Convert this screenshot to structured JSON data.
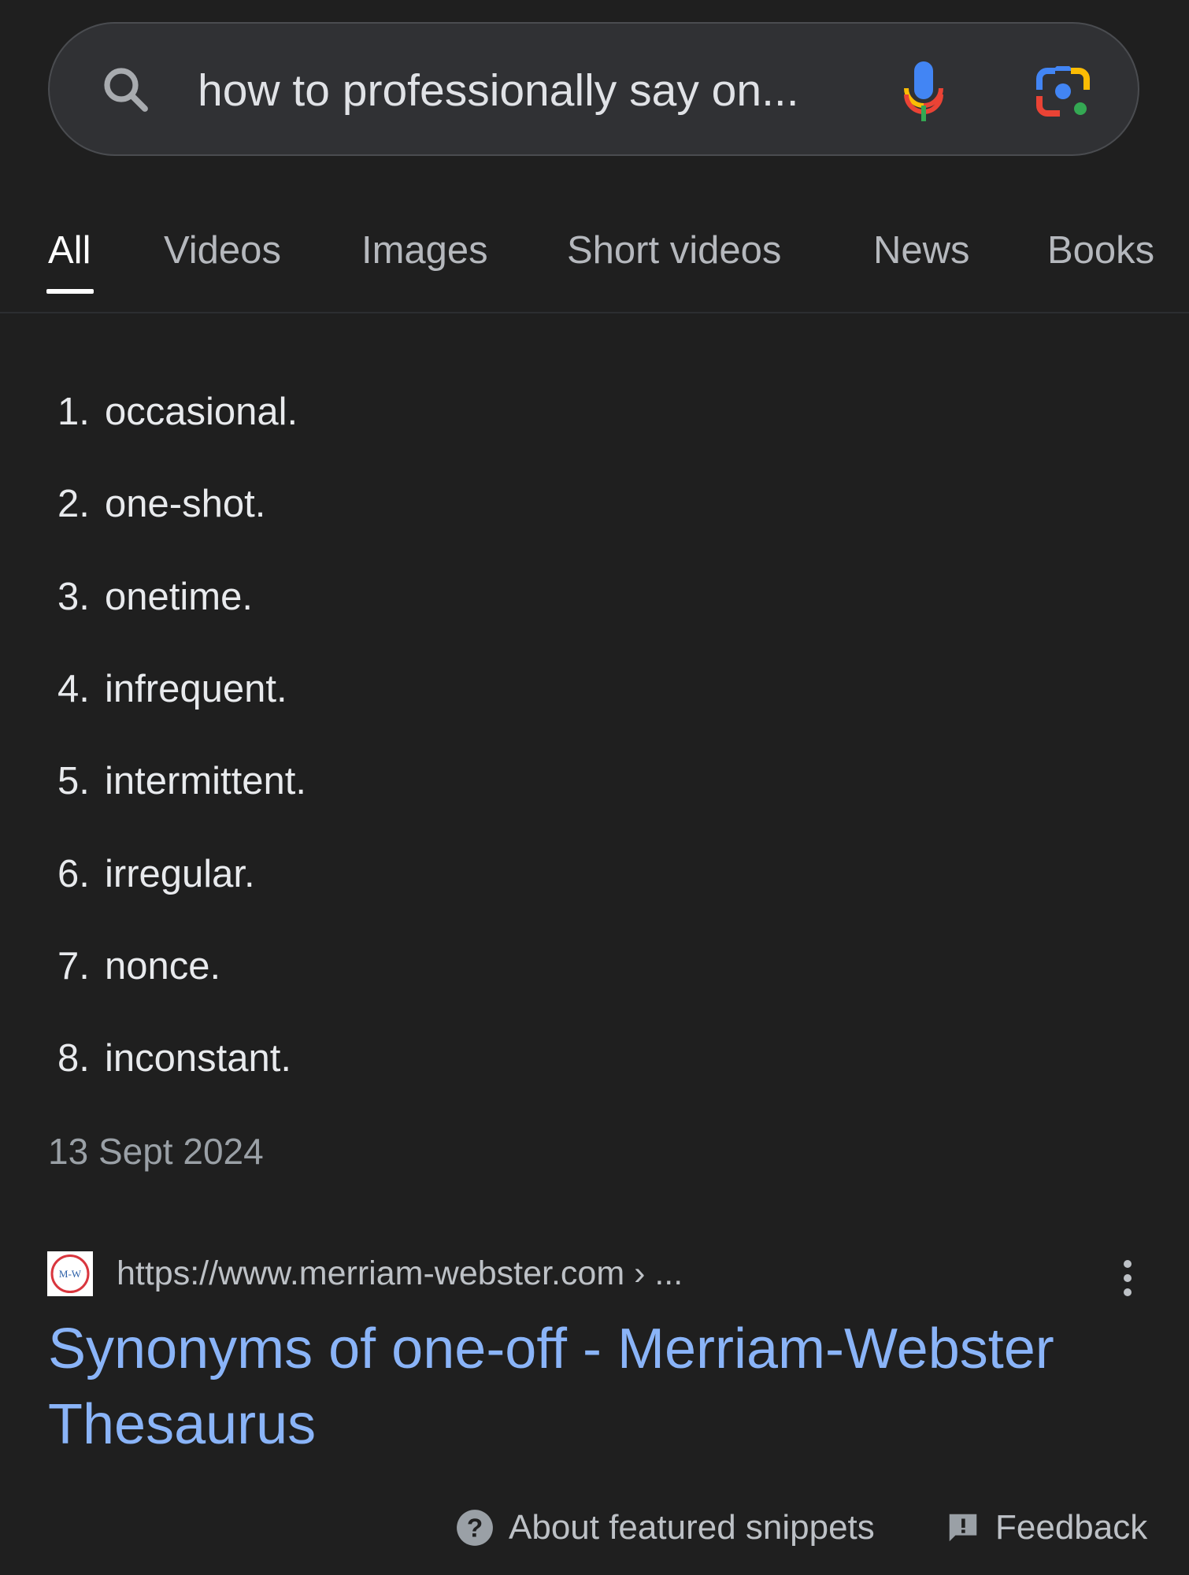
{
  "search": {
    "query": "how to professionally say on..."
  },
  "tabs": [
    {
      "label": "All",
      "active": true
    },
    {
      "label": "Videos"
    },
    {
      "label": "Images"
    },
    {
      "label": "Short videos"
    },
    {
      "label": "News"
    },
    {
      "label": "Books"
    }
  ],
  "snippet": {
    "items": [
      {
        "num": "1.",
        "text": "occasional."
      },
      {
        "num": "2.",
        "text": "one-shot."
      },
      {
        "num": "3.",
        "text": "onetime."
      },
      {
        "num": "4.",
        "text": "infrequent."
      },
      {
        "num": "5.",
        "text": "intermittent."
      },
      {
        "num": "6.",
        "text": "irregular."
      },
      {
        "num": "7.",
        "text": "nonce."
      },
      {
        "num": "8.",
        "text": "inconstant."
      }
    ],
    "date": "13 Sept 2024"
  },
  "result": {
    "favicon_text": "M-W",
    "url": "https://www.merriam-webster.com › ...",
    "title": "Synonyms of one-off - Merriam-Webster Thesaurus"
  },
  "footer": {
    "about": "About featured snippets",
    "feedback": "Feedback"
  },
  "colors": {
    "background": "#1f1f1f",
    "link": "#8ab4f8",
    "muted": "#9aa0a6"
  }
}
